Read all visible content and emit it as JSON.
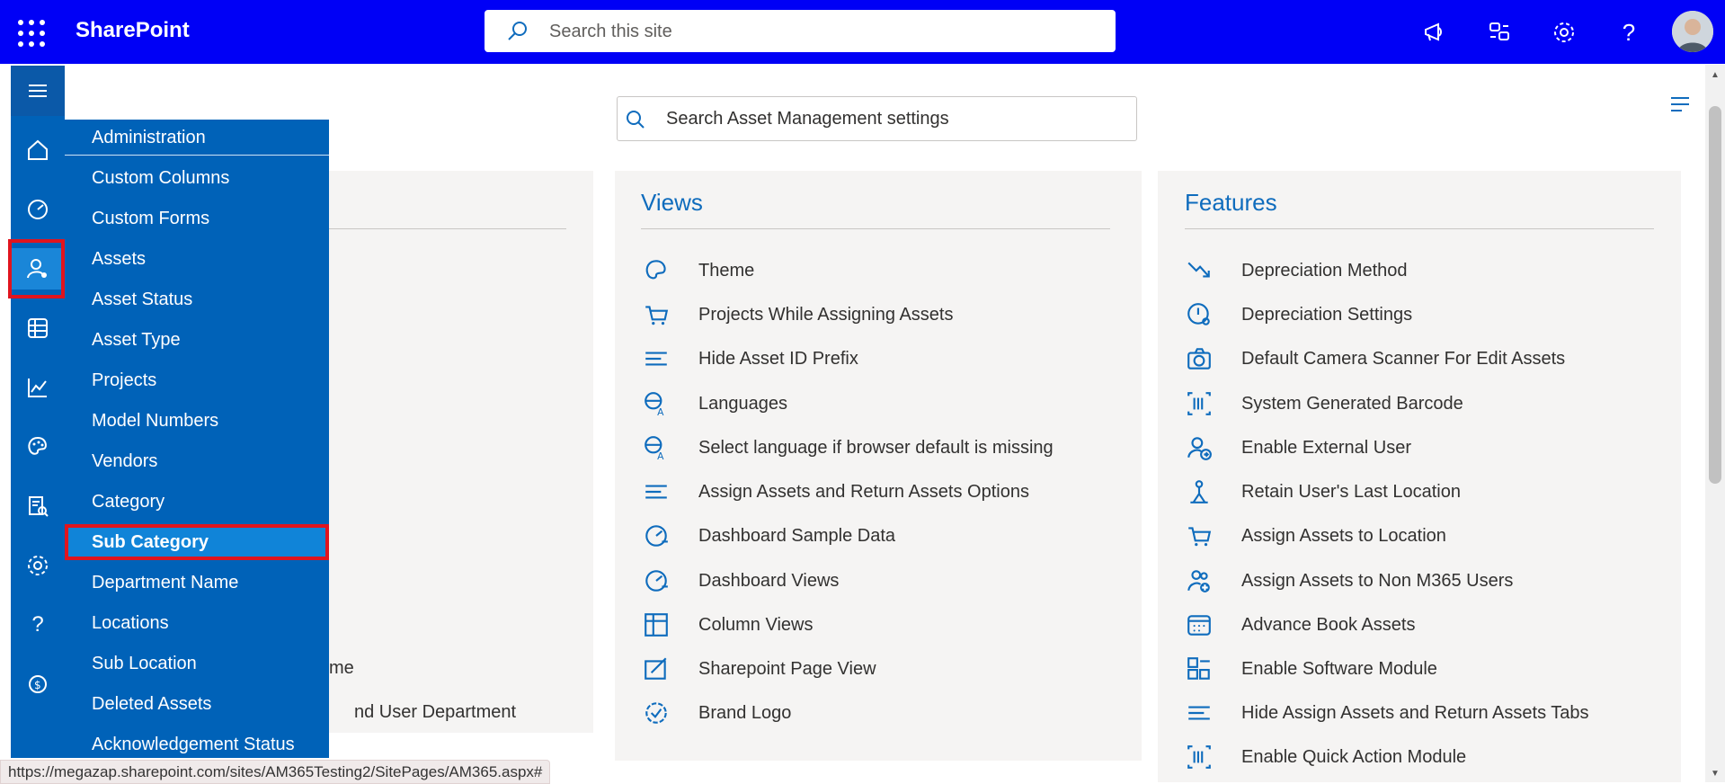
{
  "app": {
    "title": "SharePoint",
    "search_placeholder": "Search this site",
    "help_label": "?"
  },
  "rail": {
    "icons": [
      "menu-icon",
      "home-icon",
      "dashboard-icon",
      "user-settings-icon",
      "table-icon",
      "chart-icon",
      "palette-icon",
      "report-icon",
      "gear-icon",
      "help-icon",
      "billing-icon"
    ]
  },
  "flyout": {
    "items": [
      "Administration",
      "Custom Columns",
      "Custom Forms",
      "Assets",
      "Asset Status",
      "Asset Type",
      "Projects",
      "Model Numbers",
      "Vendors",
      "Category",
      "Sub Category",
      "Department Name",
      "Locations",
      "Sub Location",
      "Deleted Assets",
      "Acknowledgement Status"
    ],
    "selected": "Sub Category"
  },
  "settings_search": {
    "placeholder": "Search Asset Management settings"
  },
  "left_panel_peek": [
    "me",
    "nd User Department"
  ],
  "views": {
    "title": "Views",
    "items": [
      "Theme",
      "Projects While Assigning Assets",
      "Hide Asset ID Prefix",
      "Languages",
      "Select language if browser default is missing",
      "Assign Assets and Return Assets Options",
      "Dashboard Sample Data",
      "Dashboard Views",
      "Column Views",
      "Sharepoint Page View",
      "Brand Logo"
    ]
  },
  "features": {
    "title": "Features",
    "items": [
      "Depreciation Method",
      "Depreciation Settings",
      "Default Camera Scanner For Edit Assets",
      "System Generated Barcode",
      "Enable External User",
      "Retain User's Last Location",
      "Assign Assets to Location",
      "Assign Assets to Non M365 Users",
      "Advance Book Assets",
      "Enable Software Module",
      "Hide Assign Assets and Return Assets Tabs",
      "Enable Quick Action Module"
    ]
  },
  "status_bar": {
    "url": "https://megazap.sharepoint.com/sites/AM365Testing2/SitePages/AM365.aspx#"
  },
  "colors": {
    "topbar": "#0000f6",
    "rail": "#0062b8",
    "selected": "#1084d8",
    "highlight": "#e0141e",
    "accent": "#0f6cbd"
  }
}
